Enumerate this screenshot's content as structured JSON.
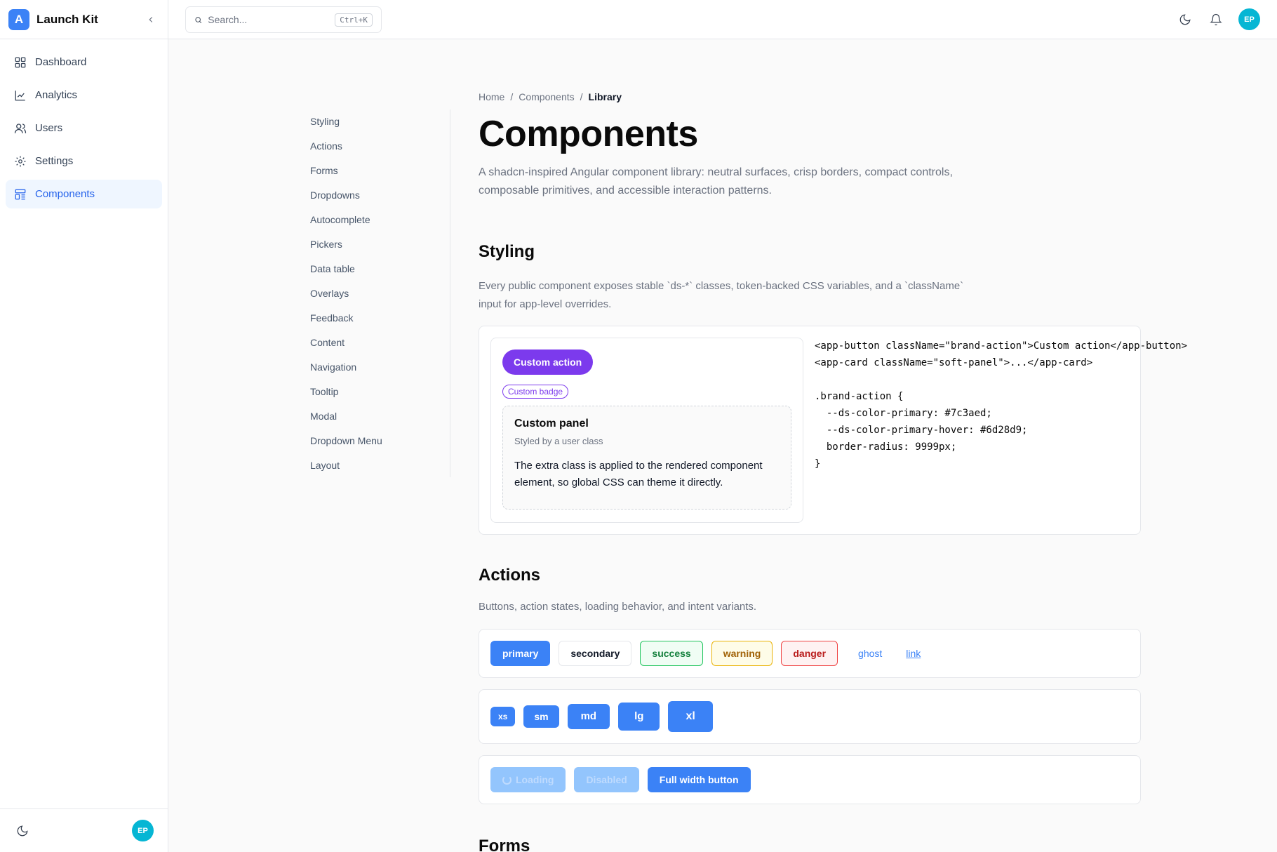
{
  "brand": {
    "logo_letter": "A",
    "name": "Launch Kit"
  },
  "sidebar": {
    "items": [
      {
        "label": "Dashboard",
        "icon": "grid-icon"
      },
      {
        "label": "Analytics",
        "icon": "chart-line-icon"
      },
      {
        "label": "Users",
        "icon": "users-icon"
      },
      {
        "label": "Settings",
        "icon": "gear-icon"
      },
      {
        "label": "Components",
        "icon": "components-icon",
        "active": true
      }
    ],
    "footer_avatar": "EP"
  },
  "topbar": {
    "search_placeholder": "Search...",
    "search_shortcut": "Ctrl+K",
    "avatar": "EP"
  },
  "section_nav": [
    "Styling",
    "Actions",
    "Forms",
    "Dropdowns",
    "Autocomplete",
    "Pickers",
    "Data table",
    "Overlays",
    "Feedback",
    "Content",
    "Navigation",
    "Tooltip",
    "Modal",
    "Dropdown Menu",
    "Layout"
  ],
  "breadcrumb": [
    "Home",
    "Components",
    "Library"
  ],
  "page": {
    "title": "Components",
    "description": "A shadcn-inspired Angular component library: neutral surfaces, crisp borders, compact controls, composable primitives, and accessible interaction patterns."
  },
  "styling": {
    "title": "Styling",
    "description": "Every public component exposes stable `ds-*` classes, token-backed CSS variables, and a `className` input for app-level overrides.",
    "button_label": "Custom action",
    "badge_label": "Custom badge",
    "panel_title": "Custom panel",
    "panel_subtitle": "Styled by a user class",
    "panel_body": "The extra class is applied to the rendered component element, so global CSS can theme it directly.",
    "code": "<app-button className=\"brand-action\">Custom action</app-button>\n<app-card className=\"soft-panel\">...</app-card>\n\n.brand-action {\n  --ds-color-primary: #7c3aed;\n  --ds-color-primary-hover: #6d28d9;\n  border-radius: 9999px;\n}",
    "accent_color": "#7c3aed"
  },
  "actions": {
    "title": "Actions",
    "description": "Buttons, action states, loading behavior, and intent variants.",
    "variants": [
      "primary",
      "secondary",
      "success",
      "warning",
      "danger",
      "ghost",
      "link"
    ],
    "sizes": [
      "xs",
      "sm",
      "md",
      "lg",
      "xl"
    ],
    "states": {
      "loading": "Loading",
      "disabled": "Disabled",
      "full_width": "Full width button"
    }
  },
  "forms": {
    "title": "Forms"
  },
  "colors": {
    "primary": "#3b82f6",
    "avatar": "#06b6d4"
  }
}
